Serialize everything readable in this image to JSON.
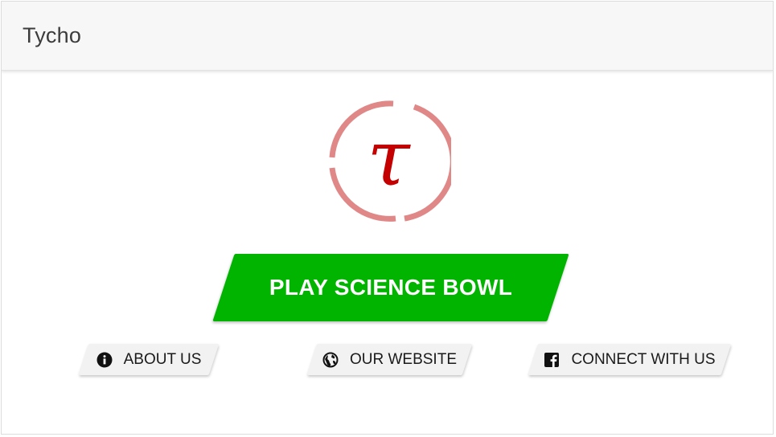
{
  "header": {
    "title": "Tycho"
  },
  "logo": {
    "symbol": "τ",
    "ring_color": "#e08787",
    "symbol_color": "#c40000"
  },
  "main": {
    "play_label": "PLAY SCIENCE BOWL",
    "play_color": "#00b400"
  },
  "links": {
    "about_label": "ABOUT US",
    "website_label": "OUR WEBSITE",
    "connect_label": "CONNECT WITH US"
  },
  "icons": {
    "about": "info-icon",
    "website": "globe-icon",
    "connect": "facebook-icon"
  }
}
